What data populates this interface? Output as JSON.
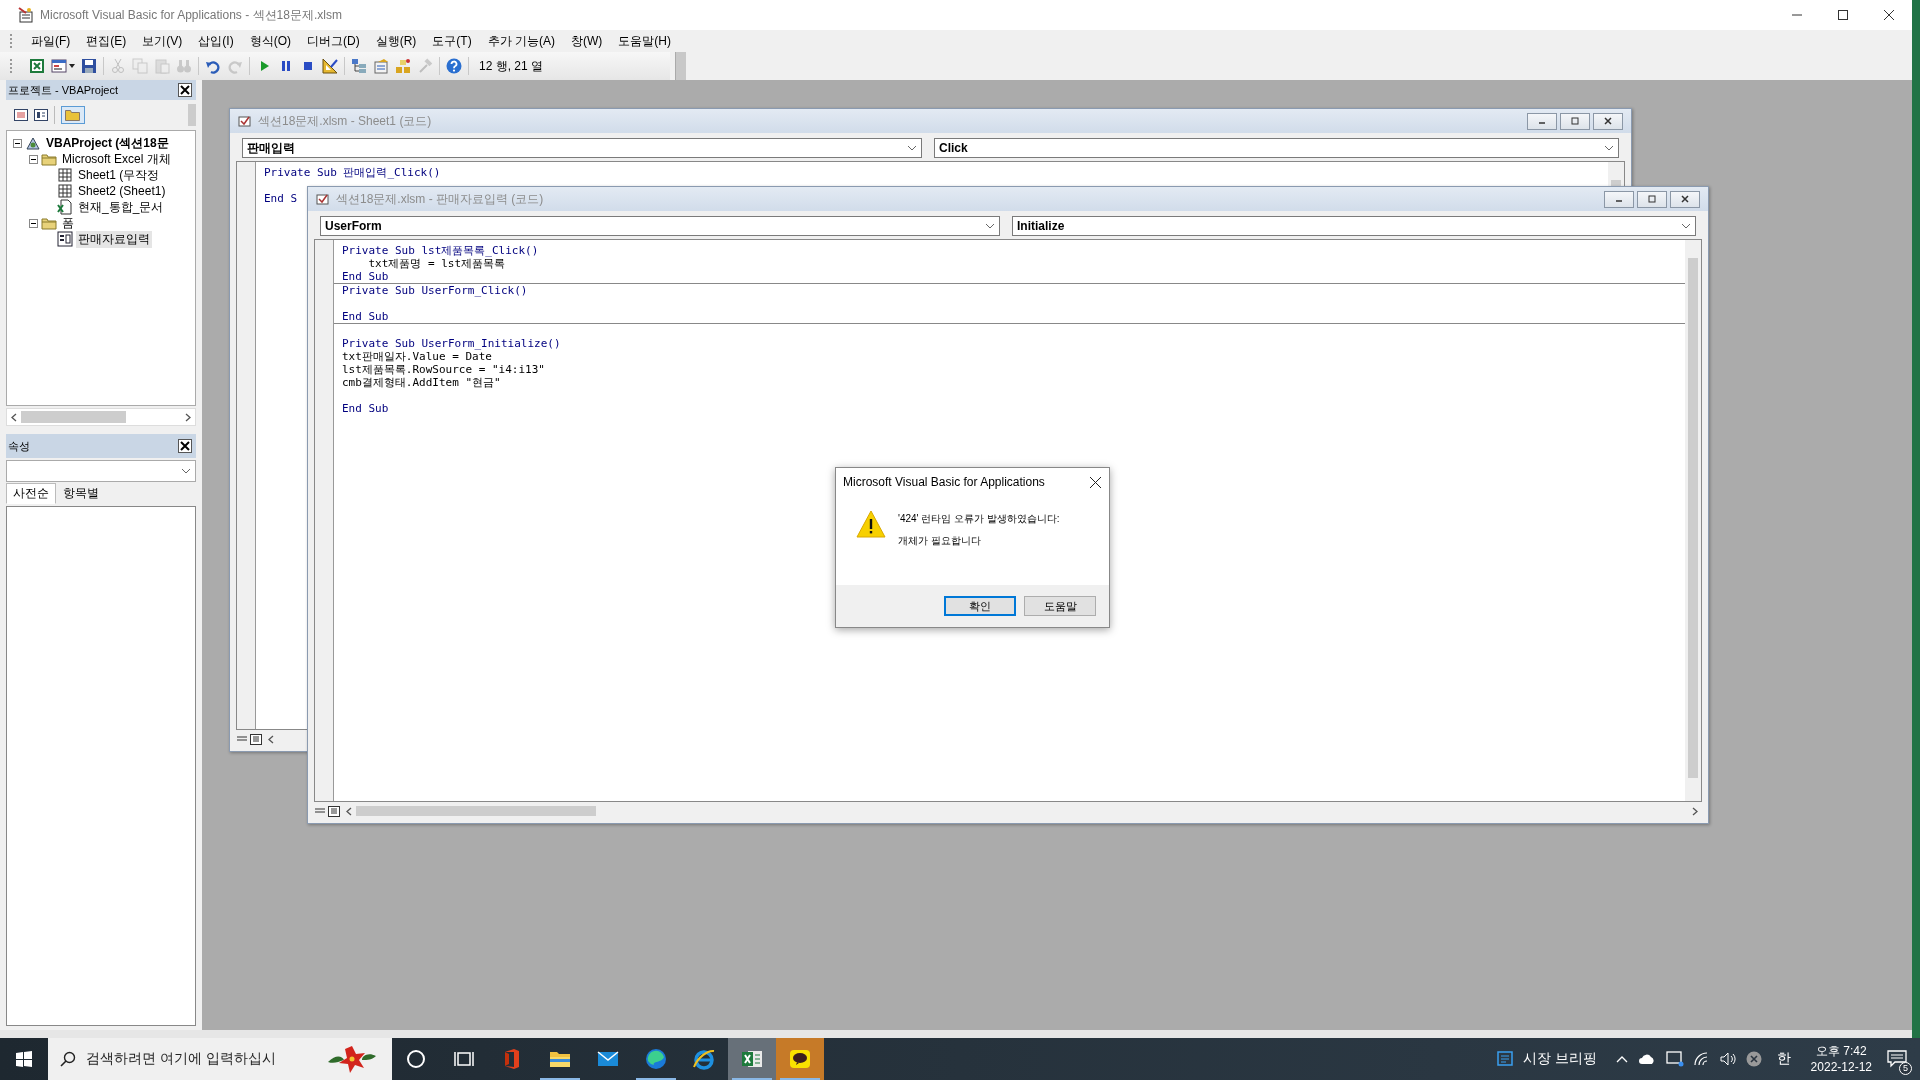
{
  "window": {
    "title": "Microsoft Visual Basic for Applications - 섹션18문제.xlsm"
  },
  "menu": [
    "파일(F)",
    "편집(E)",
    "보기(V)",
    "삽입(I)",
    "형식(O)",
    "디버그(D)",
    "실행(R)",
    "도구(T)",
    "추가 기능(A)",
    "창(W)",
    "도움말(H)"
  ],
  "toolbar": {
    "groups": [
      [
        {
          "kind": "excel",
          "disabled": false
        },
        {
          "kind": "userform",
          "disabled": false
        },
        {
          "kind": "save",
          "disabled": false
        }
      ],
      [
        {
          "kind": "cut",
          "disabled": true
        },
        {
          "kind": "copy",
          "disabled": true
        },
        {
          "kind": "paste",
          "disabled": true
        },
        {
          "kind": "find",
          "disabled": true
        }
      ],
      [
        {
          "kind": "undo",
          "disabled": false
        },
        {
          "kind": "redo",
          "disabled": true
        }
      ],
      [
        {
          "kind": "run",
          "disabled": false
        },
        {
          "kind": "break",
          "disabled": false
        },
        {
          "kind": "reset",
          "disabled": false
        },
        {
          "kind": "design",
          "disabled": false
        }
      ],
      [
        {
          "kind": "project",
          "disabled": false
        },
        {
          "kind": "properties",
          "disabled": false
        },
        {
          "kind": "browser",
          "disabled": false
        },
        {
          "kind": "toolbox",
          "disabled": true
        }
      ],
      [
        {
          "kind": "help",
          "disabled": false
        }
      ]
    ],
    "position": "12 행, 21 열"
  },
  "project_panel": {
    "title": "프로젝트 - VBAProject",
    "tree": [
      {
        "label": "VBAProject (섹션18문",
        "kind": "project",
        "expanded": true,
        "selected": false,
        "children": [
          {
            "label": "Microsoft Excel 개체",
            "kind": "folder",
            "expanded": true,
            "selected": false,
            "children": [
              {
                "label": "Sheet1 (무작정",
                "kind": "sheet",
                "selected": false
              },
              {
                "label": "Sheet2 (Sheet1)",
                "kind": "sheet",
                "selected": false
              },
              {
                "label": "현재_통합_문서",
                "kind": "workbook",
                "selected": false
              }
            ]
          },
          {
            "label": "폼",
            "kind": "folder",
            "expanded": true,
            "selected": false,
            "children": [
              {
                "label": "판매자료입력",
                "kind": "form",
                "selected": true
              }
            ]
          }
        ]
      }
    ]
  },
  "properties_panel": {
    "title": "속성",
    "tabs": [
      {
        "label": "사전순",
        "selected": true
      },
      {
        "label": "항목별",
        "selected": false
      }
    ]
  },
  "code_windows": [
    {
      "title": "섹션18문제.xlsm - Sheet1 (코드)",
      "object": "판매입력",
      "procedure": "Click",
      "procedures": [
        {
          "lines": [
            {
              "text": "Private Sub 판매입력_Click()",
              "kind": "keyword",
              "blank_before": false
            },
            {
              "text": "End S",
              "kind": "keyword",
              "blank_before": true
            }
          ]
        }
      ]
    },
    {
      "title": "섹션18문제.xlsm - 판매자료입력 (코드)",
      "object": "UserForm",
      "procedure": "Initialize",
      "procedures": [
        {
          "lines": [
            {
              "text": "Private Sub lst제품목록_Click()",
              "kind": "keyword",
              "blank_before": false
            },
            {
              "text": "    txt제품명 = lst제품목록",
              "kind": "plain",
              "blank_before": false
            },
            {
              "text": "End Sub",
              "kind": "keyword",
              "blank_before": false
            }
          ]
        },
        {
          "lines": [
            {
              "text": "Private Sub UserForm_Click()",
              "kind": "keyword",
              "blank_before": false
            },
            {
              "text": "End Sub",
              "kind": "keyword",
              "blank_before": true
            }
          ]
        },
        {
          "lines": [
            {
              "text": "Private Sub UserForm_Initialize()",
              "kind": "keyword",
              "blank_before": true
            },
            {
              "text": "txt판매일자.Value = Date",
              "kind": "plain",
              "blank_before": false
            },
            {
              "text": "lst제품목록.RowSource = \"i4:i13\"",
              "kind": "plain",
              "blank_before": false
            },
            {
              "text": "cmb결제형태.AddItem \"현금\"",
              "kind": "plain",
              "blank_before": false
            },
            {
              "text": "End Sub",
              "kind": "keyword",
              "blank_before": true
            }
          ]
        }
      ]
    }
  ],
  "dialog": {
    "title": "Microsoft Visual Basic for Applications",
    "message": [
      "'424' 런타임 오류가 발생하였습니다:",
      "개체가 필요합니다"
    ],
    "buttons": [
      {
        "label": "확인",
        "default": true
      },
      {
        "label": "도움말",
        "default": false
      }
    ]
  },
  "taskbar": {
    "search": "검색하려면 여기에 입력하십시",
    "apps": [
      {
        "kind": "office",
        "running": false,
        "selected": false,
        "attention": false
      },
      {
        "kind": "explorer",
        "running": true,
        "selected": false,
        "attention": false
      },
      {
        "kind": "mail",
        "running": false,
        "selected": false,
        "attention": false
      },
      {
        "kind": "edge",
        "running": true,
        "selected": false,
        "attention": false
      },
      {
        "kind": "ie",
        "running": false,
        "selected": false,
        "attention": false
      },
      {
        "kind": "excel",
        "running": true,
        "selected": true,
        "attention": false
      },
      {
        "kind": "talk",
        "running": true,
        "selected": false,
        "attention": true
      }
    ],
    "news": "시장 브리핑",
    "ime": "한",
    "time": "오후 7:42",
    "date": "2022-12-12",
    "notifications": "5"
  }
}
